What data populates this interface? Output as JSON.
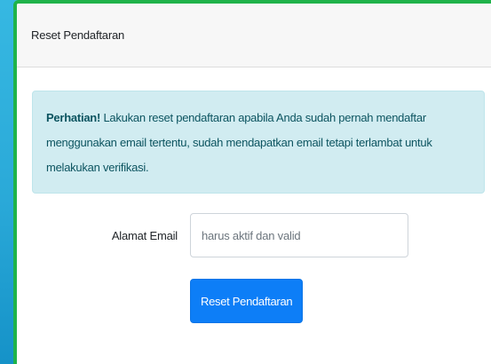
{
  "card": {
    "title": "Reset Pendaftaran"
  },
  "alert": {
    "strong": "Perhatian!",
    "message": " Lakukan reset pendaftaran apabila Anda sudah pernah mendaftar menggunakan email tertentu, sudah mendapatkan email tetapi terlambat untuk melakukan verifikasi."
  },
  "form": {
    "email_label": "Alamat Email",
    "email_placeholder": "harus aktif dan valid",
    "email_value": "",
    "submit_label": "Reset Pendaftaran"
  },
  "colors": {
    "card_border": "#1fb34a",
    "alert_bg": "#d1ecf1",
    "alert_text": "#0c5460",
    "button_bg": "#0d7ef7",
    "background": "#2aa6d4"
  }
}
